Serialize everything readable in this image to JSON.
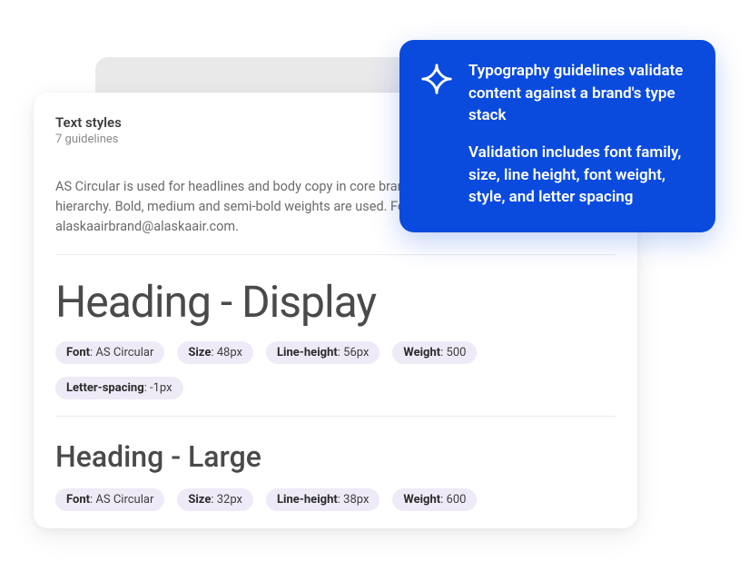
{
  "card": {
    "title": "Text styles",
    "subtitle": "7 guidelines",
    "description": "AS Circular is used for headlines and body copy in core brand materials to establish a clear hierarchy. Bold, medium and semi-bold weights are used. For questions contact alaskaairbrand@alaskaair.com."
  },
  "styles": [
    {
      "name": "Heading - Display",
      "tags": [
        {
          "label": "Font",
          "value": "AS Circular"
        },
        {
          "label": "Size",
          "value": "48px"
        },
        {
          "label": "Line-height",
          "value": "56px"
        },
        {
          "label": "Weight",
          "value": "500"
        },
        {
          "label": "Letter-spacing",
          "value": "-1px"
        }
      ]
    },
    {
      "name": "Heading - Large",
      "tags": [
        {
          "label": "Font",
          "value": "AS Circular"
        },
        {
          "label": "Size",
          "value": "32px"
        },
        {
          "label": "Line-height",
          "value": "38px"
        },
        {
          "label": "Weight",
          "value": "600"
        }
      ]
    }
  ],
  "callout": {
    "p1": "Typography guidelines validate content against a brand's type stack",
    "p2": "Validation includes font family, size, line height, font weight, style, and letter spacing"
  }
}
